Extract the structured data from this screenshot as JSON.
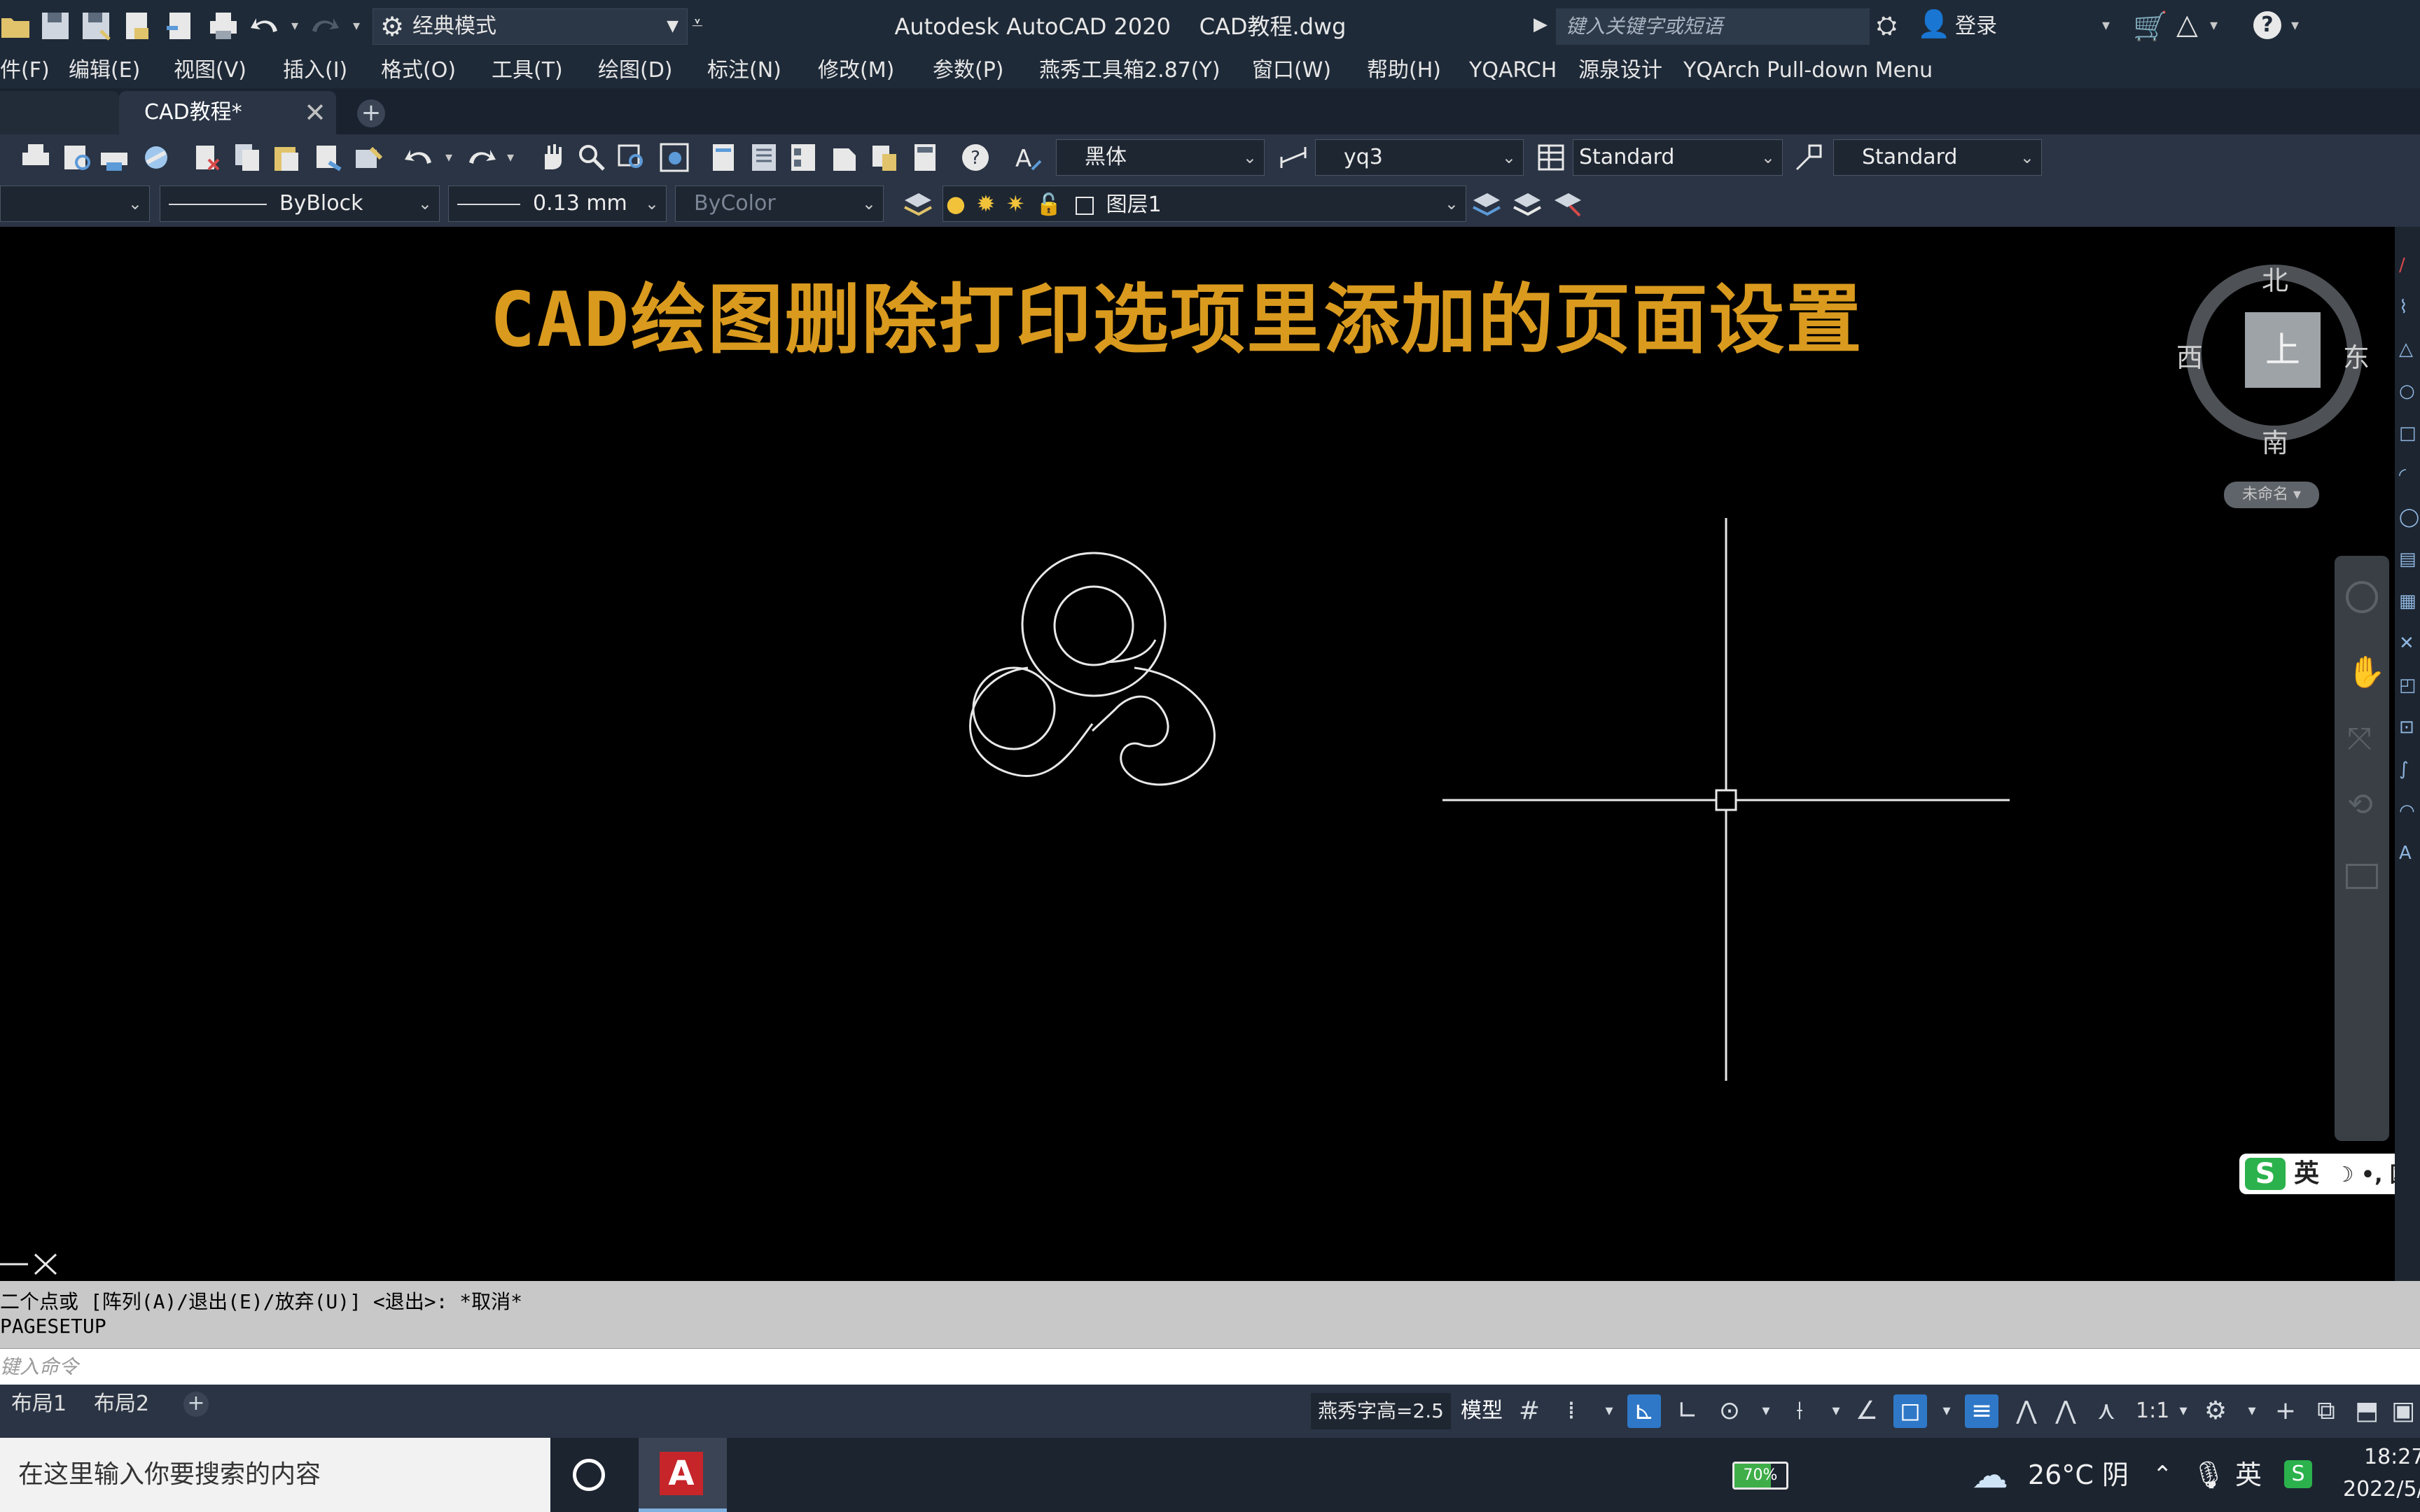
{
  "title_bar": {
    "workspace": "经典模式",
    "app_title": "Autodesk AutoCAD 2020    CAD教程.dwg",
    "search_placeholder": "键入关键字或短语",
    "login": "登录"
  },
  "menu": {
    "items": [
      "件(F)",
      "编辑(E)",
      "视图(V)",
      "插入(I)",
      "格式(O)",
      "工具(T)",
      "绘图(D)",
      "标注(N)",
      "修改(M)",
      "参数(P)",
      "燕秀工具箱2.87(Y)",
      "窗口(W)",
      "帮助(H)",
      "YQARCH",
      "源泉设计",
      "YQArch Pull-down Menu"
    ]
  },
  "tabs": {
    "document": "CAD教程*",
    "close_glyph": "✕",
    "add_glyph": "+"
  },
  "toolbar1": {
    "text_style_font": "黑体",
    "dim_style": "yq3",
    "table_style": "Standard",
    "multileader_style": "Standard"
  },
  "toolbar2": {
    "layer_color": "",
    "linetype": "ByBlock",
    "lineweight": "0.13 mm",
    "plot_style": "ByColor",
    "current_layer": "图层1"
  },
  "drawing": {
    "title": "CAD绘图删除打印选项里添加的页面设置",
    "viewcube": {
      "north": "北",
      "south": "南",
      "west": "西",
      "east": "东",
      "top": "上"
    },
    "ucs_name": "未命名",
    "ime": {
      "lang": "英",
      "extra": "☽ •, 囯"
    }
  },
  "command": {
    "history_line1": "二个点或 [阵列(A)/退出(E)/放弃(U)] <退出>: *取消*",
    "history_line2": "PAGESETUP",
    "input_placeholder": "键入命令"
  },
  "layout_tabs": [
    "布局1",
    "布局2"
  ],
  "status": {
    "text_height": "燕秀字高=2.5",
    "model": "模型",
    "annotation_scale": "1:1"
  },
  "taskbar": {
    "search_placeholder": "在这里输入你要搜索的内容",
    "battery_percent": 70,
    "battery_label": "70%",
    "weather": "26°C  阴",
    "ime": "英",
    "time": "18:27",
    "date": "2022/5/"
  },
  "colors": {
    "title_text": "#d99a1e",
    "ribbon_bg": "#2a3444",
    "canvas_bg": "#000000",
    "active_toggle": "#2f78c8"
  }
}
